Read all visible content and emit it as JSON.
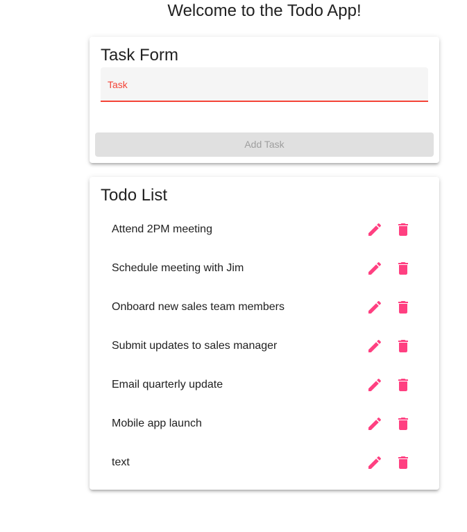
{
  "header": {
    "title": "Welcome to the Todo App!"
  },
  "task_form": {
    "title": "Task Form",
    "field_label": "Task",
    "field_value": "",
    "add_button_label": "Add Task"
  },
  "todo_list": {
    "title": "Todo List",
    "items": [
      {
        "text": "Attend 2PM meeting"
      },
      {
        "text": "Schedule meeting with Jim"
      },
      {
        "text": "Onboard new sales team members"
      },
      {
        "text": "Submit updates to sales manager"
      },
      {
        "text": "Email quarterly update"
      },
      {
        "text": "Mobile app launch"
      },
      {
        "text": "text"
      }
    ],
    "edit_icon": "pencil-icon",
    "delete_icon": "trash-icon"
  },
  "colors": {
    "accent": "#f44336",
    "icon": "#ff4081",
    "button_disabled_bg": "#e0e0e0",
    "button_disabled_text": "#9e9e9e"
  }
}
